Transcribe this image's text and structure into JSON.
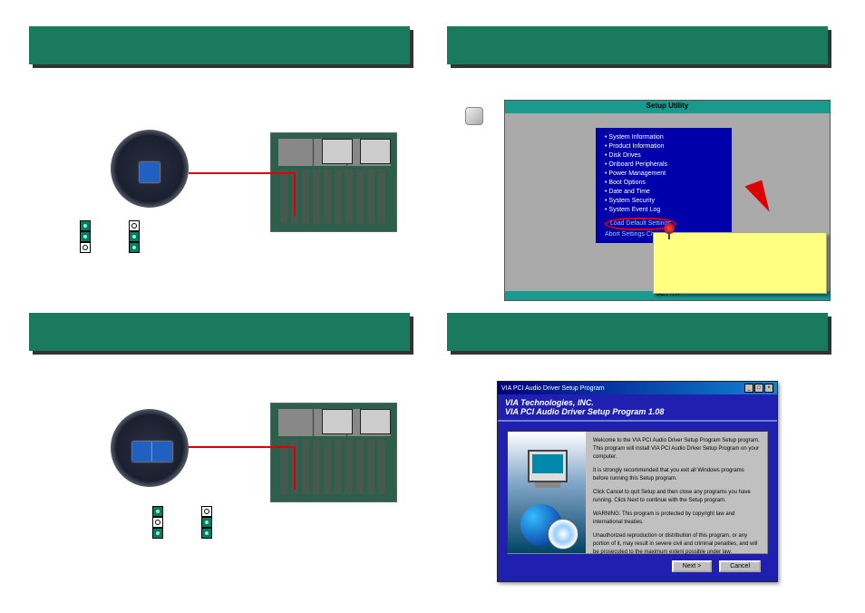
{
  "bios": {
    "title": "Setup Utility",
    "items": [
      "System Information",
      "Product Information",
      "Disk Drives",
      "Onboard Peripherals",
      "Power Management",
      "Boot Options",
      "Date and Time",
      "System Security",
      "System Event Log"
    ],
    "highlighted": "Load Default Settings",
    "after_highlight": "Abort Settings Change",
    "footer": "<ALT+H>"
  },
  "installer": {
    "titlebar": "VIA PCI Audio Driver Setup Program",
    "header_company": "VIA Technologies, INC.",
    "header_product": "VIA PCI Audio Driver Setup Program 1.08",
    "para1": "Welcome to the VIA PCI Audio Driver Setup Program Setup program. This program will install VIA PCI Audio Driver Setup Program on your computer.",
    "para2": "It is strongly recommended that you exit all Windows programs before running this Setup program.",
    "para3": "Click Cancel to quit Setup and then close any programs you have running. Click Next to continue with the Setup program.",
    "para4": "WARNING: This program is protected by copyright law and international treaties.",
    "para5": "Unauthorized reproduction or distribution of this program, or any portion of it, may result in severe civil and criminal penalties, and will be prosecuted to the maximum extent possible under law.",
    "btn_next": "Next >",
    "btn_cancel": "Cancel",
    "min_glyph": "_",
    "max_glyph": "□",
    "close_glyph": "×"
  }
}
